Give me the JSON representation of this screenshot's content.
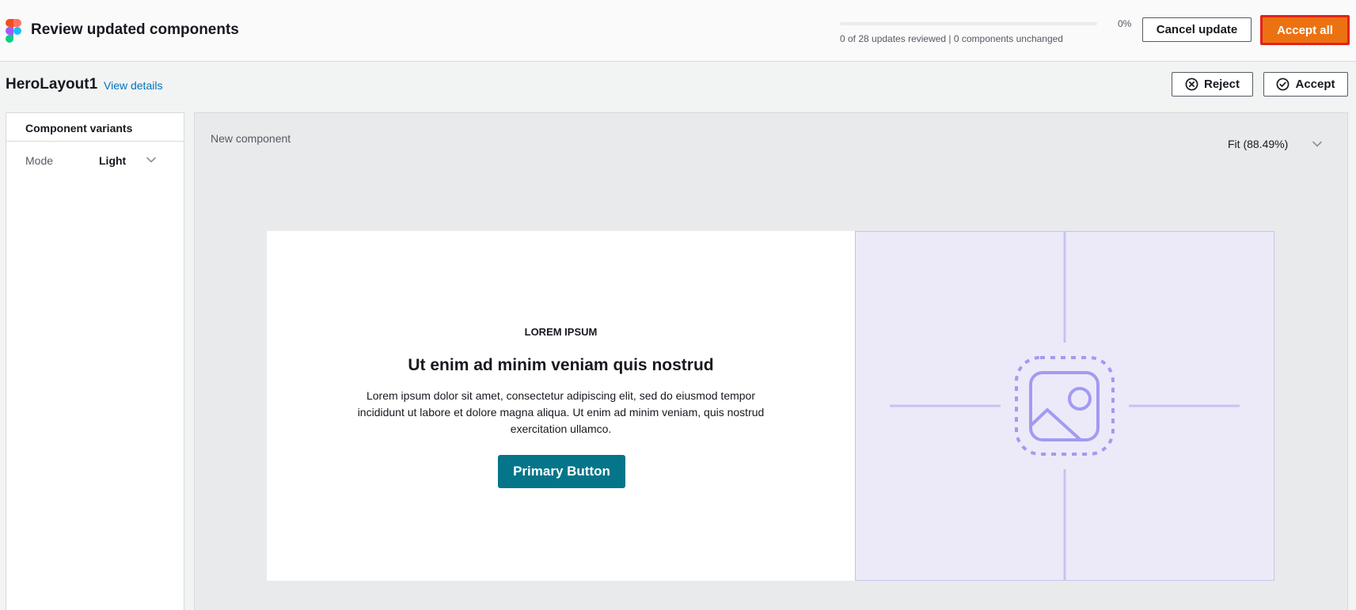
{
  "header": {
    "title": "Review updated components",
    "progress_percent_label": "0%",
    "progress_fraction": 0,
    "progress_text": "0 of 28 updates reviewed | 0 components unchanged",
    "cancel_label": "Cancel update",
    "accept_all_label": "Accept all"
  },
  "component": {
    "name": "HeroLayout1",
    "view_details_label": "View details",
    "reject_label": "Reject",
    "accept_label": "Accept"
  },
  "sidebar": {
    "title": "Component variants",
    "mode_label": "Mode",
    "mode_value": "Light"
  },
  "main": {
    "label": "New component",
    "zoom_label": "Fit (88.49%)"
  },
  "preview": {
    "eyebrow": "LOREM IPSUM",
    "heading": "Ut enim ad minim veniam quis nostrud",
    "body": "Lorem ipsum dolor sit amet, consectetur adipiscing elit, sed do eiusmod tempor incididunt ut labore et dolore magna aliqua. Ut enim ad minim veniam, quis nostrud exercitation ullamco.",
    "button_label": "Primary Button"
  },
  "colors": {
    "accent": "#ec7211",
    "highlight_border": "#e2231a",
    "link": "#0073bb",
    "preview_button": "#05758a",
    "image_placeholder_bg": "#eceaf9",
    "image_placeholder_stroke": "#a29bf0"
  },
  "icons": {
    "app_logo": "figma-logo-icon",
    "reject": "x-circle-icon",
    "accept": "check-circle-icon",
    "dropdown": "chevron-down-icon",
    "placeholder": "image-placeholder-icon"
  }
}
